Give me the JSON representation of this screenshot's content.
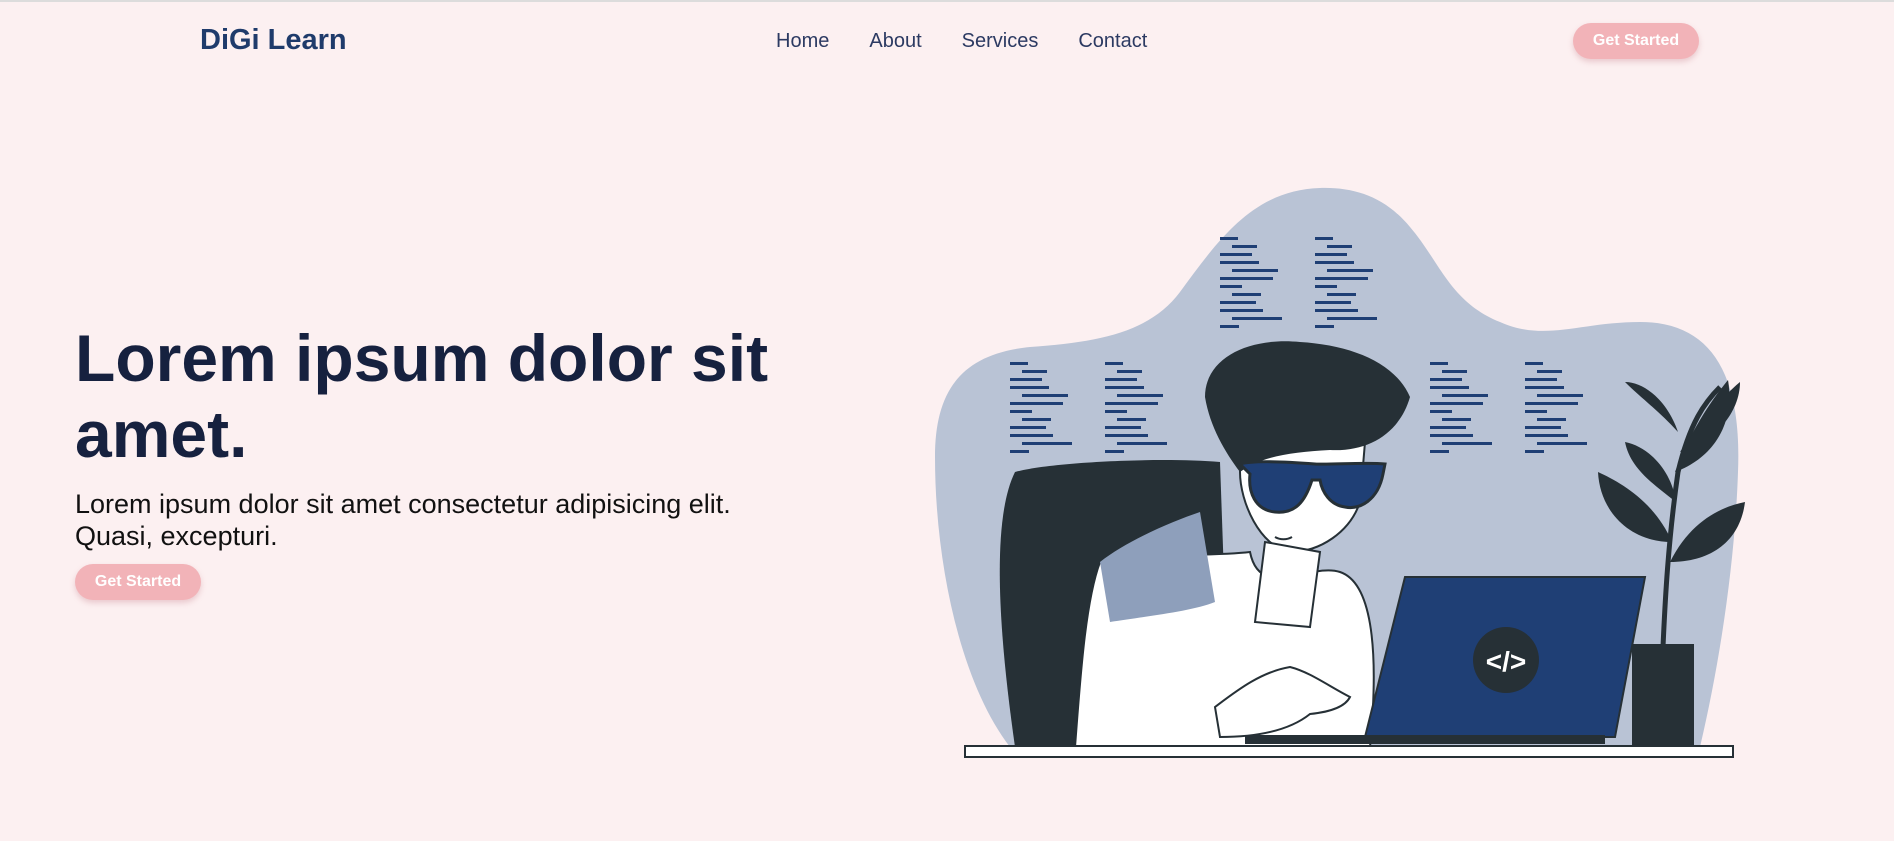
{
  "brand": {
    "name": "DiGi Learn"
  },
  "nav": {
    "links": [
      "Home",
      "About",
      "Services",
      "Contact"
    ],
    "cta_label": "Get Started"
  },
  "hero": {
    "title_line1": "Lorem ipsum dolor sit",
    "title_line2": "amet.",
    "subtitle": "Lorem ipsum dolor sit amet consectetur adipisicing elit. Quasi, excepturi.",
    "cta_label": "Get Started"
  },
  "illustration": {
    "code_badge": "</>"
  },
  "colors": {
    "background": "#fcf0f1",
    "accent": "#f2b3b8",
    "brand": "#1f3b6b",
    "heading": "#16213f",
    "blob": "#b9c3d5",
    "laptop": "#1f3f75",
    "dark": "#263036"
  }
}
